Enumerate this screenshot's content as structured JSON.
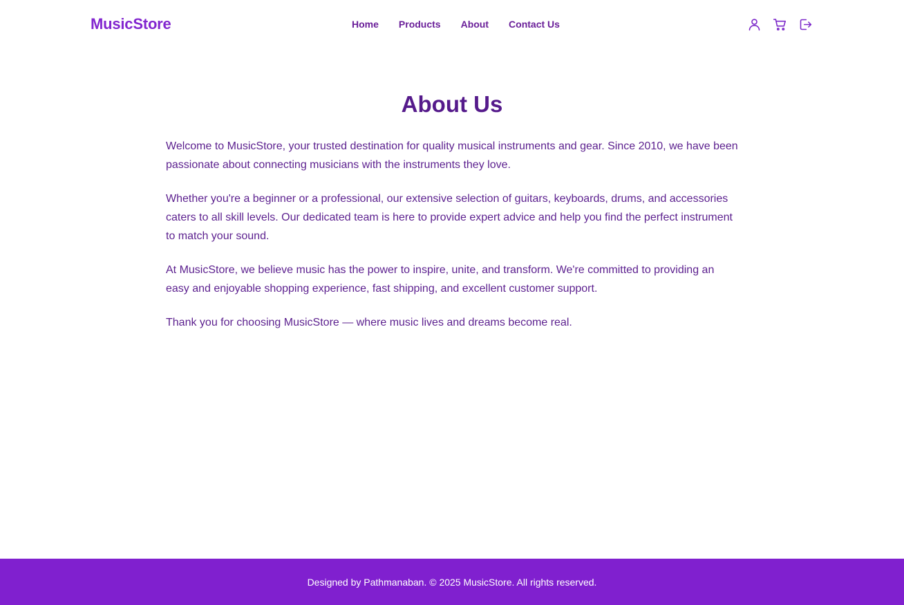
{
  "header": {
    "brand": "MusicStore",
    "nav": [
      {
        "label": "Home"
      },
      {
        "label": "Products"
      },
      {
        "label": "About"
      },
      {
        "label": "Contact Us"
      }
    ],
    "icons": [
      "user-icon",
      "cart-icon",
      "logout-icon"
    ]
  },
  "main": {
    "title": "About Us",
    "paragraphs": [
      "Welcome to MusicStore, your trusted destination for quality musical instruments and gear. Since 2010, we have been passionate about connecting musicians with the instruments they love.",
      "Whether you're a beginner or a professional, our extensive selection of guitars, keyboards, drums, and accessories caters to all skill levels. Our dedicated team is here to provide expert advice and help you find the perfect instrument to match your sound.",
      "At MusicStore, we believe music has the power to inspire, unite, and transform. We're committed to providing an easy and enjoyable shopping experience, fast shipping, and excellent customer support.",
      "Thank you for choosing MusicStore — where music lives and dreams become real."
    ]
  },
  "footer": {
    "text": "Designed by Pathmanaban. © 2025 MusicStore. All rights reserved."
  },
  "colors": {
    "brand": "#8226cf",
    "nav_text": "#6a1f99",
    "title": "#551a8b",
    "body_text": "#5b1f8e",
    "footer_bg": "#8020cf"
  }
}
